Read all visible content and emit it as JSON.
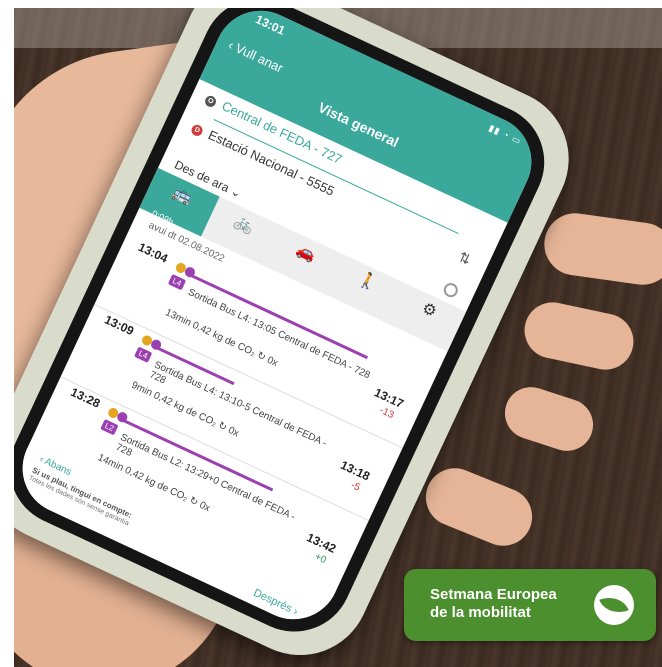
{
  "app": {
    "status_time": "13:01",
    "back_label": "Vull anar",
    "title": "Vista general",
    "origin": "Central de FEDA - 727",
    "origin_marker": "O",
    "destination": "Estació Nacional - 5555",
    "destination_marker": "D",
    "departure_mode": "Des de ara",
    "modes": [
      {
        "icon": "bus-icon",
        "label": "0:09h"
      },
      {
        "icon": "bike-icon",
        "label": ""
      },
      {
        "icon": "car-icon",
        "label": ""
      },
      {
        "icon": "walk-icon",
        "label": ""
      },
      {
        "icon": "settings-icon",
        "label": ""
      }
    ],
    "date": "avui dt 02.08.2022",
    "trips": [
      {
        "dep": "13:04",
        "arr": "13:17",
        "delay": "-13",
        "line": "L4",
        "desc": "Sortida Bus L4: 13:05 Central de FEDA - 728",
        "meta": "13min  0,42 kg de CO₂  ↻ 0x"
      },
      {
        "dep": "13:09",
        "arr": "13:18",
        "delay": "-5",
        "line": "L4",
        "desc": "Sortida Bus L4: 13:10-5 Central de FEDA - 728",
        "meta": "9min  0,42 kg de CO₂  ↻ 0x"
      },
      {
        "dep": "13:28",
        "arr": "13:42",
        "delay": "+0",
        "line": "L2",
        "desc": "Sortida Bus L2: 13:29+0 Central de FEDA - 728",
        "meta": "14min  0,42 kg de CO₂  ↻ 0x"
      }
    ],
    "prev_label": "Abans",
    "notice": "Si us plau, tingui en compte:",
    "notice_detail": "Totes les dades són sense garantia",
    "next_label": "Després"
  },
  "badge": {
    "line1": "Setmana Europea",
    "line2": "de la mobilitat"
  },
  "colors": {
    "accent": "#3aa99b",
    "line_purple": "#9b3fb1",
    "badge_green": "#4c8f2e"
  }
}
